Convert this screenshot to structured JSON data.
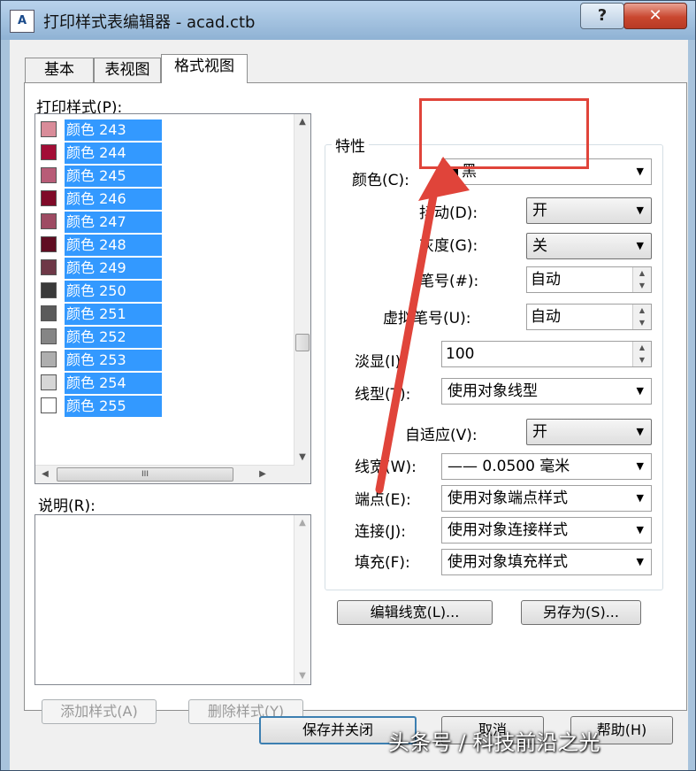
{
  "window": {
    "title": "打印样式表编辑器 - acad.ctb",
    "app_icon_text": "A",
    "help_glyph": "?",
    "close_glyph": "✕"
  },
  "tabs": [
    {
      "label": "基本"
    },
    {
      "label": "表视图"
    },
    {
      "label": "格式视图",
      "active": true
    }
  ],
  "styles_list": {
    "label": "打印样式(P):",
    "items": [
      {
        "name": "颜色 243",
        "color": "#d98c99"
      },
      {
        "name": "颜色 244",
        "color": "#a30d36"
      },
      {
        "name": "颜色 245",
        "color": "#b85c77"
      },
      {
        "name": "颜色 246",
        "color": "#7f0a28"
      },
      {
        "name": "颜色 247",
        "color": "#9e4b63"
      },
      {
        "name": "颜色 248",
        "color": "#600d22"
      },
      {
        "name": "颜色 249",
        "color": "#6e3847"
      },
      {
        "name": "颜色 250",
        "color": "#3a3a3a"
      },
      {
        "name": "颜色 251",
        "color": "#5b5b5b"
      },
      {
        "name": "颜色 252",
        "color": "#858585"
      },
      {
        "name": "颜色 253",
        "color": "#aeaeae"
      },
      {
        "name": "颜色 254",
        "color": "#d6d6d6"
      },
      {
        "name": "颜色 255",
        "color": "#ffffff"
      }
    ],
    "h_scroll_grip": "III"
  },
  "description": {
    "label": "说明(R):"
  },
  "list_buttons": {
    "add": "添加样式(A)",
    "delete": "删除样式(Y)"
  },
  "properties": {
    "group_title": "特性",
    "color": {
      "label": "颜色(C):",
      "value": "黑"
    },
    "dither": {
      "label": "抖动(D):",
      "value": "开"
    },
    "grayscale": {
      "label": "灰度(G):",
      "value": "关"
    },
    "pen": {
      "label": "笔号(#):",
      "value": "自动"
    },
    "virtual_pen": {
      "label": "虚拟笔号(U):",
      "value": "自动"
    },
    "screening": {
      "label": "淡显(I):",
      "value": "100"
    },
    "linetype": {
      "label": "线型(T):",
      "value": "使用对象线型"
    },
    "adaptive": {
      "label": "自适应(V):",
      "value": "开"
    },
    "lineweight": {
      "label": "线宽(W):",
      "value": "—— 0.0500 毫米"
    },
    "line_end": {
      "label": "端点(E):",
      "value": "使用对象端点样式"
    },
    "line_join": {
      "label": "连接(J):",
      "value": "使用对象连接样式"
    },
    "fill": {
      "label": "填充(F):",
      "value": "使用对象填充样式"
    }
  },
  "action_buttons": {
    "edit_lineweights": "编辑线宽(L)...",
    "save_as": "另存为(S)..."
  },
  "footer_buttons": {
    "save_close": "保存并关闭",
    "cancel": "取消",
    "help": "帮助(H)"
  },
  "annotation": {
    "color": "#e0443a"
  },
  "watermark": "头条号 / 科技前沿之光"
}
